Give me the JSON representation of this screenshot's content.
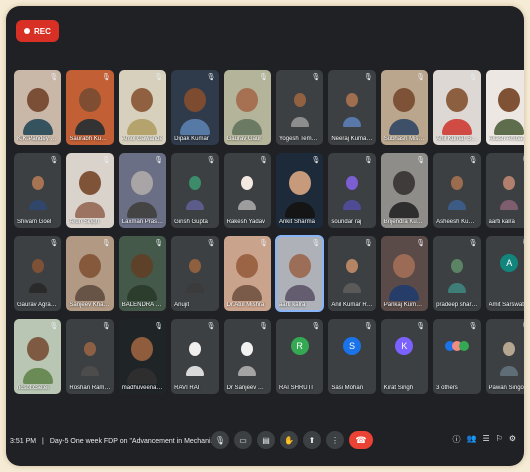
{
  "recording": {
    "label": "REC"
  },
  "participants": [
    {
      "name": "K.K.Pandey P...",
      "mode": "photo",
      "bg": "#c9b8a8",
      "skin": "#7b4f35",
      "shirt": "#35525f"
    },
    {
      "name": "Saurabh Kumar",
      "mode": "photo",
      "bg": "#c25f35",
      "skin": "#7f4d31",
      "shirt": "#333333"
    },
    {
      "name": "Amol Gawande",
      "mode": "photo",
      "bg": "#d6d0bd",
      "skin": "#8f6140",
      "shirt": "#b5a36e"
    },
    {
      "name": "Dipak Kumar",
      "mode": "photo",
      "bg": "#2f3a4a",
      "skin": "#7c4b30",
      "shirt": "#5779a6"
    },
    {
      "name": "Gaurav Gaur",
      "mode": "photo",
      "bg": "#b4b49a",
      "skin": "#a67152",
      "shirt": "#6b7a62"
    },
    {
      "name": "Yogesh Tembhu...",
      "mode": "small",
      "bg": "#3c4043",
      "skin": "#916142",
      "shirt": "#8d8d8d"
    },
    {
      "name": "Neeraj Kumar P...",
      "mode": "small",
      "bg": "#3c4043",
      "skin": "#9e6e4e",
      "shirt": "#5778a8"
    },
    {
      "name": "Subhash Mishra",
      "mode": "photo",
      "bg": "#b9a68d",
      "skin": "#7d5236",
      "shirt": "#3d5068"
    },
    {
      "name": "Anil Kumar Sh...",
      "mode": "photo",
      "bg": "#ddd8d3",
      "skin": "#8d5f41",
      "shirt": "#cf4b43"
    },
    {
      "name": "Akash Ambatkar",
      "mode": "photo",
      "bg": "#ece7e2",
      "skin": "#7f5236",
      "shirt": "#5e6d4c"
    },
    {
      "name": "Shivam Goel",
      "mode": "small",
      "bg": "#3c4043",
      "skin": "#a67353",
      "shirt": "#30466b"
    },
    {
      "name": "Arun Singh",
      "mode": "photo",
      "bg": "#d9d3cc",
      "skin": "#7f5337",
      "shirt": "#9c7360"
    },
    {
      "name": "Laxman Prasad",
      "mode": "photo",
      "bg": "#6a6f85",
      "skin": "#a9a5a6",
      "shirt": "#444444"
    },
    {
      "name": "Girish Gupta",
      "mode": "small",
      "bg": "#3c4043",
      "skin": "#3c8b6b",
      "shirt": "#5c5c8a"
    },
    {
      "name": "Rakesh Yadav",
      "mode": "small",
      "bg": "#3c4043",
      "skin": "#f4e9e2",
      "shirt": "#9d9d9d"
    },
    {
      "name": "Ankit Sharma",
      "mode": "photo",
      "bg": "#1c2a3a",
      "skin": "#c69a7b",
      "shirt": "#151515"
    },
    {
      "name": "soundar raj",
      "mode": "small",
      "bg": "#3c4043",
      "skin": "#7a5ed2",
      "shirt": "#4f4b95"
    },
    {
      "name": "Brijendra Kum...",
      "mode": "photo",
      "bg": "#8f8d8a",
      "skin": "#3f3b3a",
      "shirt": "#2e2e2e"
    },
    {
      "name": "Asheesh Kumar",
      "mode": "small",
      "bg": "#3c4043",
      "skin": "#9b6c4d",
      "shirt": "#3d5c85"
    },
    {
      "name": "aarti kalra",
      "mode": "small",
      "bg": "#3c4043",
      "skin": "#b17f6d",
      "shirt": "#7e5e6e"
    },
    {
      "name": "Gaurav Agrawal",
      "mode": "small",
      "bg": "#3c4043",
      "skin": "#7d5136",
      "shirt": "#2a2a2a"
    },
    {
      "name": "Sanjeev Khandel...",
      "mode": "photo",
      "bg": "#b19983",
      "skin": "#87593c",
      "shirt": "#675446"
    },
    {
      "name": "BALENDRA BH...",
      "mode": "photo",
      "bg": "#44594a",
      "skin": "#5e4129",
      "shirt": "#2c3d2e"
    },
    {
      "name": "Anujit",
      "mode": "small",
      "bg": "#3c4043",
      "skin": "#8e603f",
      "shirt": "#3b3b3b"
    },
    {
      "name": "Dr.Atul Mishra",
      "mode": "photo",
      "bg": "#caa38c",
      "skin": "#9b6444",
      "shirt": "#7a5a49"
    },
    {
      "name": "aarti kalra",
      "mode": "photo",
      "bg": "#aeb1b8",
      "skin": "#9c6d57",
      "shirt": "#635d6f",
      "active": true
    },
    {
      "name": "Anil Kumar Rao",
      "mode": "small",
      "bg": "#3c4043",
      "skin": "#b48465",
      "shirt": "#5a5a5a"
    },
    {
      "name": "Pankaj Kumar...",
      "mode": "photo",
      "bg": "#5a4b48",
      "skin": "#9c6b55",
      "shirt": "#263d6a"
    },
    {
      "name": "pradeep sharma",
      "mode": "small",
      "bg": "#3c4043",
      "skin": "#5b8465",
      "shirt": "#3e7d78"
    },
    {
      "name": "Amit Sarswat",
      "mode": "avatar",
      "bg": "#3c4043",
      "avatarColor": "#12857d",
      "letter": "A"
    },
    {
      "name": "ncsbt.cse.ei",
      "mode": "photo",
      "bg": "#b9c6b4",
      "skin": "#7e5a42",
      "shirt": "#6b8b56"
    },
    {
      "name": "Roshan Raman",
      "mode": "small",
      "bg": "#3c4043",
      "skin": "#8d6045",
      "shirt": "#4c4c4c"
    },
    {
      "name": "madhuveena s...",
      "mode": "photo",
      "bg": "#1f2427",
      "skin": "#8f5d3e",
      "shirt": "#2e2e2e"
    },
    {
      "name": "RAVI RAI",
      "mode": "small",
      "bg": "#3c4043",
      "skin": "#f1eeee",
      "shirt": "#d9d9d9"
    },
    {
      "name": "Dr Sanjeev Goyal",
      "mode": "small",
      "bg": "#3c4043",
      "skin": "#f1f1f1",
      "shirt": "#a4a4a4"
    },
    {
      "name": "RAI SHRUTI",
      "mode": "avatar",
      "bg": "#3c4043",
      "avatarColor": "#34a853",
      "letter": "R"
    },
    {
      "name": "Sasi Mohan",
      "mode": "avatar",
      "bg": "#3c4043",
      "avatarColor": "#1a73e8",
      "letter": "S"
    },
    {
      "name": "Kirat Singh",
      "mode": "avatar",
      "bg": "#3c4043",
      "avatarColor": "#7b61ff",
      "letter": "K"
    },
    {
      "name": "3 others",
      "mode": "others",
      "bg": "#3c4043"
    },
    {
      "name": "Pawan Singotia",
      "mode": "small",
      "bg": "#3c4043",
      "skin": "#b6a590",
      "shirt": "#5f6d77"
    }
  ],
  "bottom_bar": {
    "time": "3:51 PM",
    "separator": "|",
    "meeting_title": "Day-5 One week FDP on \"Advancement in Mechani...",
    "controls": [
      "mic-icon",
      "camera-icon",
      "captions-icon",
      "raise-hand-icon",
      "present-icon",
      "more-icon",
      "leave-call-icon"
    ],
    "right_icons": [
      "info-icon",
      "people-icon",
      "chat-icon",
      "activities-icon",
      "host-controls-icon"
    ]
  }
}
